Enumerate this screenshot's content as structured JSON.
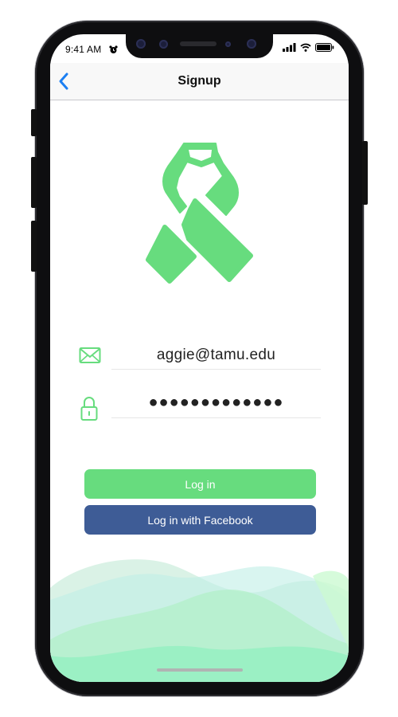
{
  "status_bar": {
    "time": "9:41 AM",
    "alarm_icon": "alarm-clock-icon",
    "signal_icon": "cellular-signal-icon",
    "wifi_icon": "wifi-icon",
    "battery_icon": "battery-icon"
  },
  "nav": {
    "title": "Signup",
    "back_icon": "chevron-left-icon"
  },
  "logo": {
    "icon": "awareness-ribbon-icon",
    "color": "#67dc7e"
  },
  "form": {
    "email": {
      "icon": "envelope-icon",
      "value": "aggie@tamu.edu"
    },
    "password": {
      "icon": "lock-icon",
      "value": "●●●●●●●●●●●●●"
    }
  },
  "buttons": {
    "login_label": "Log in",
    "facebook_label": "Log in with Facebook",
    "login_color": "#67dc7e",
    "facebook_color": "#3e5c96"
  }
}
